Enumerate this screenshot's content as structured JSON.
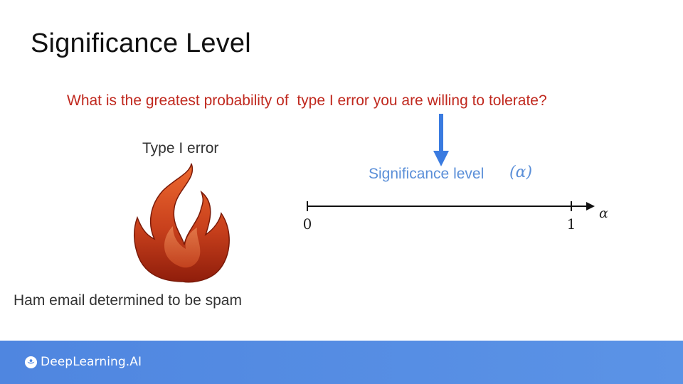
{
  "slide": {
    "title": "Significance Level",
    "question": "What is the greatest probability of  type I error you are willing to tolerate?",
    "type_error_label": "Type I error",
    "ham_label": "Ham email determined to be spam",
    "significance_label": "Significance level",
    "significance_symbol": "(α)"
  },
  "number_line": {
    "start_label": "0",
    "end_label": "1",
    "axis_symbol": "α"
  },
  "footer": {
    "brand": "DeepLearning.AI"
  },
  "colors": {
    "question": "#c0281e",
    "significance": "#5b8fd8",
    "arrow": "#3a7be0",
    "footer": "#4f86e0",
    "flame_top": "#e9622a",
    "flame_bottom": "#8f1d0b"
  },
  "icons": {
    "flame": "fire-icon",
    "arrow": "arrow-down-icon",
    "logo": "deeplearning-logo-icon"
  }
}
